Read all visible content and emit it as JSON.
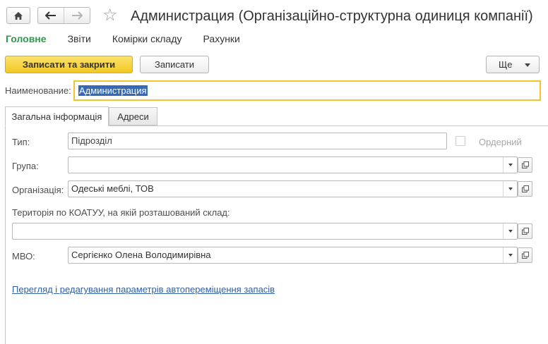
{
  "window": {
    "title": "Администрация (Організаційно-структурна одиниця компанії)"
  },
  "sections": [
    {
      "label": "Головне",
      "active": true
    },
    {
      "label": "Звіти",
      "active": false
    },
    {
      "label": "Комірки складу",
      "active": false
    },
    {
      "label": "Рахунки",
      "active": false
    }
  ],
  "commands": {
    "save_close": "Записати та закрити",
    "save": "Записати",
    "more": "Ще"
  },
  "name_field": {
    "label": "Наименование:",
    "value": "Администрация"
  },
  "tabs": [
    {
      "label": "Загальна інформація",
      "active": true
    },
    {
      "label": "Адреси",
      "active": false
    }
  ],
  "form": {
    "type": {
      "label": "Тип:",
      "value": "Підрозділ"
    },
    "ordered": {
      "label": "Ордерний",
      "checked": false
    },
    "group": {
      "label": "Група:",
      "value": ""
    },
    "organization": {
      "label": "Організація:",
      "value": "Одеські меблі, ТОВ"
    },
    "territory": {
      "label": "Територія по КОАТУУ, на якій розташований склад:",
      "value": ""
    },
    "mvo": {
      "label": "МВО:",
      "value": "Сергієнко Олена Володимирівна"
    }
  },
  "link": "Перегляд і редагування параметрів автопереміщення запасів",
  "colors": {
    "accent_green": "#2c9a4f",
    "primary_button": "#f2c822",
    "focus_border": "#f2c52f",
    "selection": "#3569b5",
    "link": "#2f5fa8"
  },
  "icons": [
    "home-icon",
    "back-arrow-icon",
    "forward-arrow-icon",
    "star-icon",
    "chevron-down-icon",
    "open-form-icon"
  ]
}
